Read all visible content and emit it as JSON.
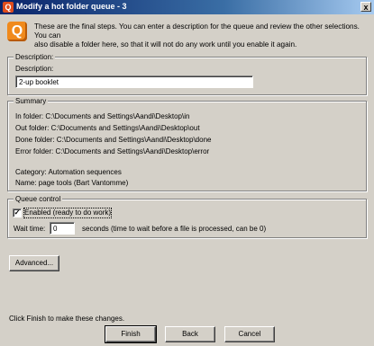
{
  "window": {
    "title": "Modify a hot folder queue - 3",
    "app_icon_glyph": "Q",
    "close_glyph": "x"
  },
  "intro": {
    "icon_glyph": "Q",
    "text": "These are the final steps. You can enter a description for the queue and review the other selections. You can\nalso disable a folder here, so that it will not do any work until you enable it again."
  },
  "description_group": {
    "legend": "Description:",
    "label": "Description:",
    "value": "2-up booklet"
  },
  "summary_group": {
    "legend": "Summary",
    "in_folder": "In folder:  C:\\Documents and Settings\\Aandi\\Desktop\\in",
    "out_folder": "Out folder:  C:\\Documents and Settings\\Aandi\\Desktop\\out",
    "done_folder": "Done folder:  C:\\Documents and Settings\\Aandi\\Desktop\\done",
    "error_folder": "Error folder:  C:\\Documents and Settings\\Aandi\\Desktop\\error",
    "category": "Category:  Automation sequences",
    "name": "Name:  page tools (Bart Vantomme)"
  },
  "queue_control_group": {
    "legend": "Queue control",
    "enabled_label": "Enabled (ready to do work)",
    "enabled_checked": true,
    "check_glyph": "✓",
    "wait_label": "Wait time:",
    "wait_value": "0",
    "wait_hint": "seconds (time to wait before a file is processed, can be 0)"
  },
  "buttons": {
    "advanced": "Advanced...",
    "finish": "Finish",
    "back": "Back",
    "cancel": "Cancel"
  },
  "footer": {
    "hint": "Click Finish to make these changes."
  },
  "colors": {
    "titlebar_start": "#0a246a",
    "titlebar_end": "#a6caf0",
    "dialog_bg": "#d4d0c8",
    "icon_accent": "#f08a1c"
  }
}
